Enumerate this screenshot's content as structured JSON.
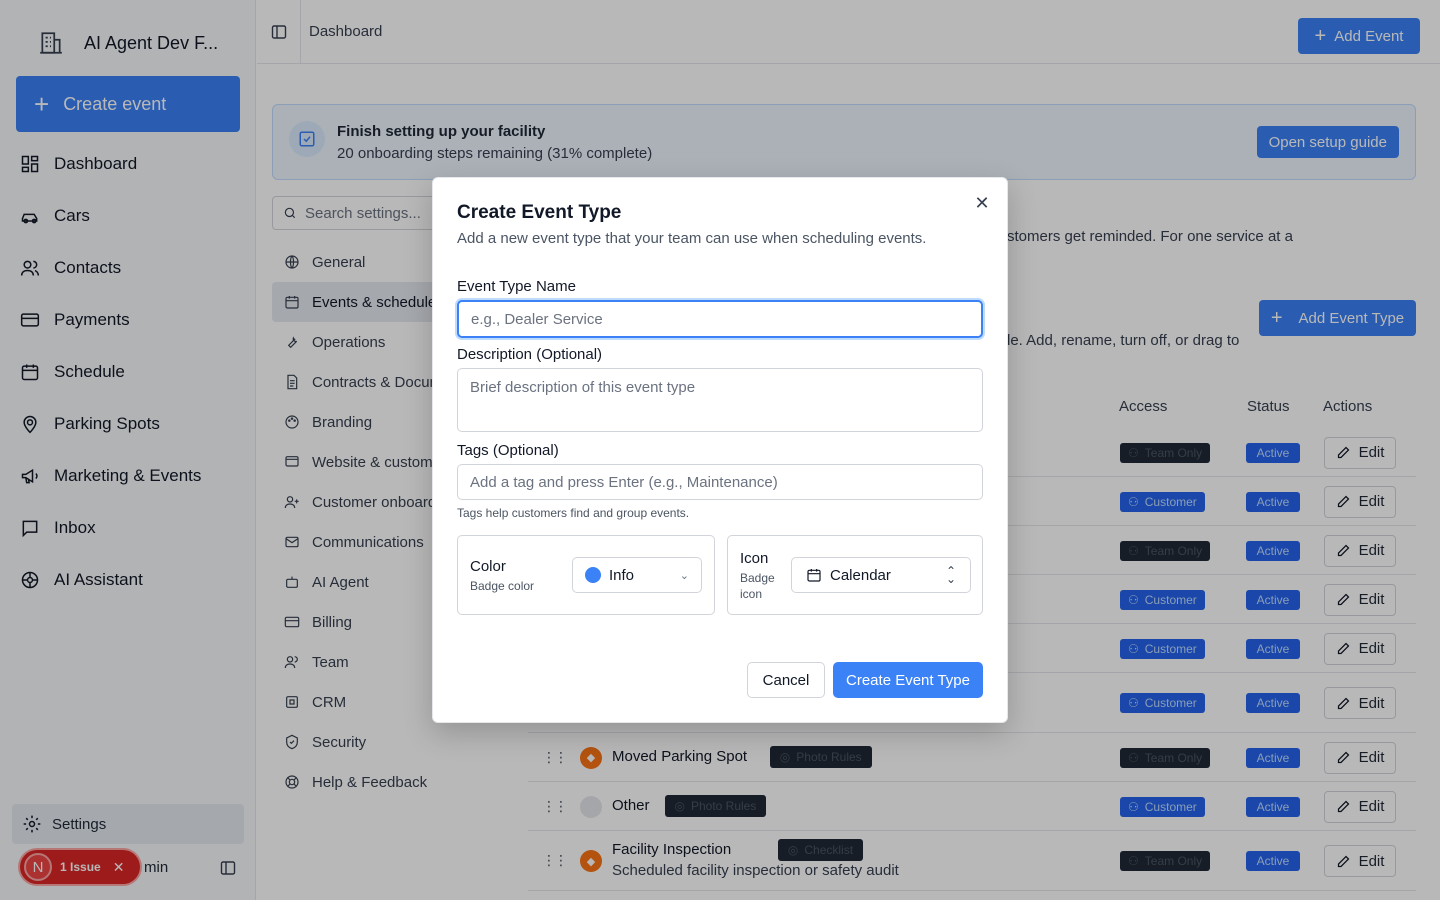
{
  "sidebar": {
    "brand": "AI Agent Dev F...",
    "create_label": "Create event",
    "items": [
      {
        "label": "Dashboard",
        "icon": "dashboard-icon"
      },
      {
        "label": "Cars",
        "icon": "car-icon"
      },
      {
        "label": "Contacts",
        "icon": "contacts-icon"
      },
      {
        "label": "Payments",
        "icon": "payments-icon"
      },
      {
        "label": "Schedule",
        "icon": "calendar-icon"
      },
      {
        "label": "Parking Spots",
        "icon": "map-pin-icon"
      },
      {
        "label": "Marketing & Events",
        "icon": "megaphone-icon"
      },
      {
        "label": "Inbox",
        "icon": "inbox-icon"
      },
      {
        "label": "AI Assistant",
        "icon": "ai-icon"
      }
    ],
    "settings_label": "Settings",
    "issue_letter": "N",
    "issue_label": "1 Issue",
    "user_partial": "min"
  },
  "topbar": {
    "breadcrumb": "Dashboard",
    "add_event": "Add Event"
  },
  "banner": {
    "title": "Finish setting up your facility",
    "subtitle": "20 onboarding steps remaining (31% complete)",
    "button": "Open setup guide"
  },
  "settings_nav": {
    "search_placeholder": "Search settings...",
    "items": [
      "General",
      "Events & schedule",
      "Operations",
      "Contracts & Documents",
      "Branding",
      "Website & customer",
      "Customer onboarding",
      "Communications",
      "AI Agent",
      "Billing",
      "Team",
      "CRM",
      "Security",
      "Help & Feedback"
    ]
  },
  "content": {
    "desc1": "stomers get reminded. For one service at a",
    "desc2": "le. Add, rename, turn off, or drag to",
    "add_type": "Add Event Type",
    "columns": {
      "access": "Access",
      "status": "Status",
      "actions": "Actions"
    },
    "rows": [
      {
        "name": "",
        "tag": "",
        "sub": "",
        "access": "Team Only",
        "status": "Active",
        "edit": "Edit"
      },
      {
        "name": "",
        "tag": "",
        "sub": "",
        "access": "Customer",
        "status": "Active",
        "edit": "Edit"
      },
      {
        "name": "",
        "tag": "",
        "sub": "",
        "access": "Team Only",
        "status": "Active",
        "edit": "Edit"
      },
      {
        "name": "",
        "tag": "",
        "sub": "",
        "access": "Customer",
        "status": "Active",
        "edit": "Edit"
      },
      {
        "name": "",
        "tag": "",
        "sub": "",
        "access": "Customer",
        "status": "Active",
        "edit": "Edit"
      },
      {
        "name": "",
        "tag": "",
        "sub": "",
        "access": "Customer",
        "status": "Active",
        "edit": "Edit"
      },
      {
        "name": "Moved Parking Spot",
        "tag": "Photo Rules",
        "sub": "",
        "access": "Team Only",
        "status": "Active",
        "edit": "Edit"
      },
      {
        "name": "Other",
        "tag": "Photo Rules",
        "sub": "",
        "access": "Customer",
        "status": "Active",
        "edit": "Edit"
      },
      {
        "name": "Facility Inspection",
        "tag": "Checklist",
        "sub": "Scheduled facility inspection or safety audit",
        "access": "Team Only",
        "status": "Active",
        "edit": "Edit"
      }
    ]
  },
  "modal": {
    "title": "Create Event Type",
    "subtitle": "Add a new event type that your team can use when scheduling events.",
    "name_label": "Event Type Name",
    "name_placeholder": "e.g., Dealer Service",
    "desc_label": "Description (Optional)",
    "desc_placeholder": "Brief description of this event type",
    "tags_label": "Tags (Optional)",
    "tags_placeholder": "Add a tag and press Enter (e.g., Maintenance)",
    "tags_hint": "Tags help customers find and group events.",
    "color_label": "Color",
    "color_sub": "Badge color",
    "color_value": "Info",
    "icon_label": "Icon",
    "icon_sub1": "Badge",
    "icon_sub2": "icon",
    "icon_value": "Calendar",
    "cancel": "Cancel",
    "create": "Create Event Type"
  },
  "colors": {
    "primary": "#3b82f6",
    "issue": "#dc2626"
  }
}
